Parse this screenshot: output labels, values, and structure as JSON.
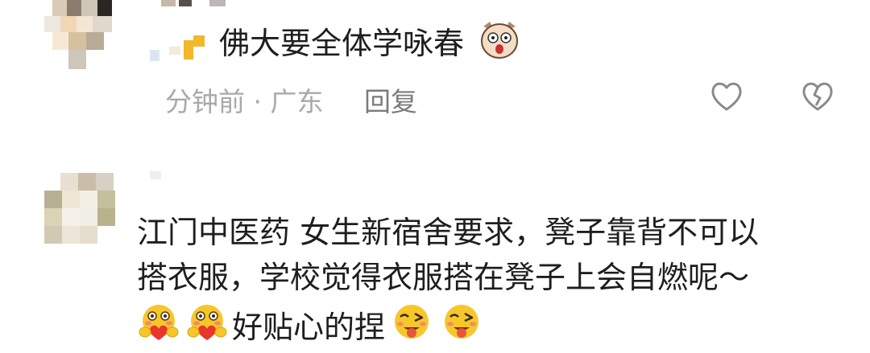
{
  "comments": [
    {
      "text": "佛大要全体学咏春",
      "time_location": "分钟前 · 广东",
      "reply_label": "回复",
      "emoji_after": "dog-face-emoji"
    },
    {
      "text_line1": "江门中医药 女生新宿舍要求，凳子靠背不可以",
      "text_line2": "搭衣服，学校觉得衣服搭在凳子上会自燃呢～",
      "text_line3": "好贴心的捏",
      "emojis_before": [
        "blushing-heart-emoji",
        "blushing-heart-emoji"
      ],
      "emojis_after": [
        "winking-tongue-emoji",
        "winking-tongue-emoji"
      ]
    }
  ],
  "icons": {
    "like": "heart-outline-icon",
    "dislike": "broken-heart-icon"
  },
  "colors": {
    "text": "#1e1e1e",
    "meta": "#a9a9a9",
    "reply": "#7b7b7b",
    "emoji_yellow": "#f7c72a"
  }
}
